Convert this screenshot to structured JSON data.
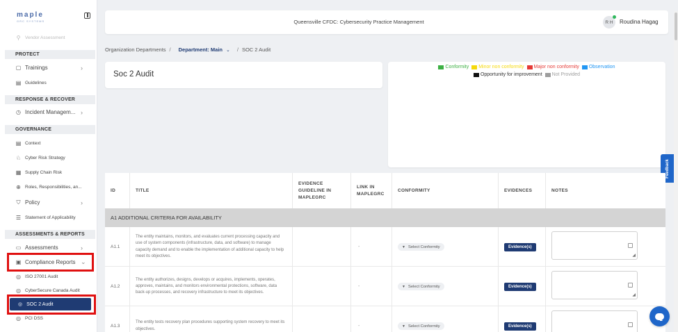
{
  "app": {
    "logo": "maple",
    "logo_sub": "GRC SYSTEMS",
    "header_title": "Queensville CFDC: Cybersecurity Practice Management",
    "user_initials": "R H",
    "user_name": "Roudina Hagag"
  },
  "sidebar": {
    "faded_top": "Vendor Assessment",
    "sections": {
      "protect": "PROTECT",
      "response": "RESPONSE & RECOVER",
      "governance": "GOVERNANCE",
      "assessments": "ASSESSMENTS & REPORTS"
    },
    "items": {
      "trainings": "Trainings",
      "guidelines": "Guidelines",
      "incident": "Incident Managem...",
      "context": "Context",
      "cyber_risk": "Cyber Risk Strategy",
      "supply_chain": "Supply Chain Risk",
      "roles": "Roles, Responsibilities, an...",
      "policy": "Policy",
      "soa": "Statement of Applicability",
      "assessments": "Assessments",
      "compliance": "Compliance Reports",
      "iso": "ISO 27001 Audit",
      "cybersecure": "CyberSecure Canada Audit",
      "soc2": "SOC 2 Audit",
      "pcidss": "PCI DSS"
    }
  },
  "breadcrumb": {
    "org": "Organization Departments",
    "sep": "/",
    "dept": "Department: Main",
    "current": "SOC 2 Audit"
  },
  "page_title": "Soc 2 Audit",
  "legend": {
    "items": [
      {
        "label": "Conformity",
        "color": "#3cb043"
      },
      {
        "label": "Minor non conformity",
        "color": "#f5d90a"
      },
      {
        "label": "Major non conformity",
        "color": "#e53935"
      },
      {
        "label": "Observation",
        "color": "#2196f3"
      },
      {
        "label": "Opportunity for improvement",
        "color": "#111111"
      },
      {
        "label": "Not Provided",
        "color": "#9e9e9e"
      }
    ]
  },
  "feedback_label": "Feedback",
  "table": {
    "headers": {
      "id": "ID",
      "title": "TITLE",
      "evidence_guideline": "EVIDENCE GUIDELINE IN MAPLEGRC",
      "link": "LINK IN MAPLEGRC",
      "conformity": "CONFORMITY",
      "evidences": "EVIDENCES",
      "notes": "NOTES"
    },
    "group": "A1 ADDITIONAL CRITERIA FOR AVAILABILITY",
    "select_label": "Select Conformity",
    "evidence_btn": "Evidence(s)",
    "rows": [
      {
        "id": "A1.1",
        "title": "The entity maintains, monitors, and evaluates current processing capacity and use of system components (infrastructure, data, and software) to manage capacity demand and to enable the implementation of additional capacity to help meet its objectives.",
        "link": "-"
      },
      {
        "id": "A1.2",
        "title": "The entity authorizes, designs, develops or acquires, implements, operates, approves, maintains, and monitors environmental protections, software, data back-up processes, and recovery infrastructure to meet its objectives.",
        "link": "-"
      },
      {
        "id": "A1.3",
        "title": "The entity tests recovery plan procedures supporting system recovery to meet its objectives.",
        "link": "-"
      }
    ]
  }
}
